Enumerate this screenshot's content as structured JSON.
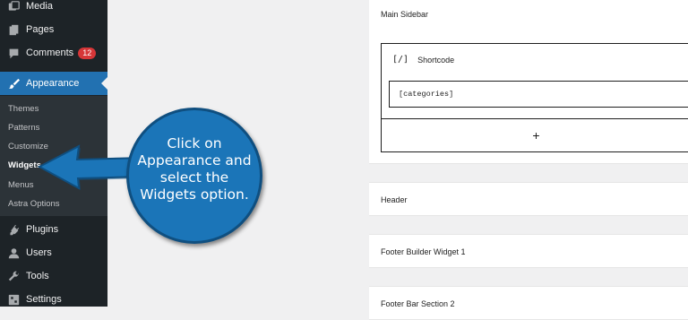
{
  "sidebar": {
    "media": "Media",
    "pages": "Pages",
    "comments": "Comments",
    "comments_badge": "12",
    "appearance": "Appearance",
    "submenu": [
      "Themes",
      "Patterns",
      "Customize",
      "Widgets",
      "Menus",
      "Astra Options"
    ],
    "plugins": "Plugins",
    "users": "Users",
    "tools": "Tools",
    "settings": "Settings"
  },
  "widgets": {
    "main_sidebar": "Main Sidebar",
    "shortcode_title": "Shortcode",
    "shortcode_icon": "[/]",
    "shortcode_value": "[categories]",
    "add_block": "+",
    "header": "Header",
    "footer_builder": "Footer Builder Widget 1",
    "footer_bar": "Footer Bar Section 2"
  },
  "callout": {
    "lines": [
      "Click on",
      "Appearance and",
      "select the",
      "Widgets option."
    ]
  },
  "colors": {
    "sidebar_bg": "#1d2327",
    "active": "#2271b1",
    "badge": "#d63638",
    "callout": "#1b75b8"
  }
}
